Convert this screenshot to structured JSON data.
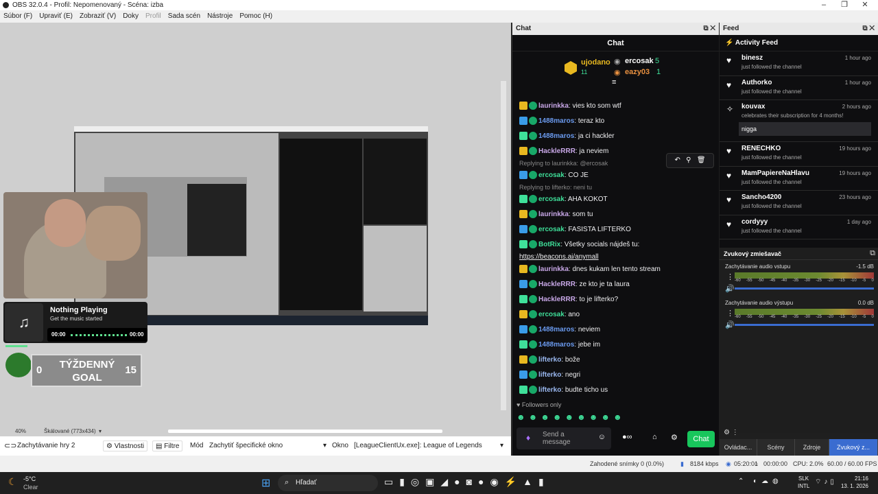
{
  "window": {
    "title": "OBS 32.0.4 - Profil: Nepomenovaný - Scéna: izba"
  },
  "menu": [
    "Súbor (F)",
    "Upraviť (E)",
    "Zobraziť (V)",
    "Doky",
    "Profil",
    "Sada scén",
    "Nástroje",
    "Pomoc (H)"
  ],
  "overlay": {
    "music_title": "Nothing Playing",
    "music_sub": "Get the music started",
    "time_start": "00:00",
    "time_end": "00:00",
    "goal_label": "TÝŽDENNÝ GOAL",
    "goal_min": "0",
    "goal_max": "15"
  },
  "preview": {
    "zoom": "40%",
    "scale": "Škálované (773x434)"
  },
  "source_bar": {
    "source": "Zachytávanie hry 2",
    "properties": "Vlastnosti",
    "filters": "Filtre",
    "mode_label": "Mód",
    "mode_value": "Zachytiť špecifické okno",
    "window_label": "Okno",
    "window_value": "[LeagueClientUx.exe]: League of Legends"
  },
  "chat": {
    "dock_title": "Chat",
    "header": "Chat",
    "leader1": {
      "name": "ujodano",
      "count": "11"
    },
    "leader2": {
      "name": "ercosak",
      "count": "5"
    },
    "leader3": {
      "name": "eazy03",
      "count": "1"
    },
    "messages": [
      {
        "user": "laurinkka",
        "text": "vies kto som wtf",
        "color": "#c9a8e8"
      },
      {
        "user": "1488maros",
        "text": "teraz kto",
        "color": "#6b9bf0"
      },
      {
        "user": "1488maros",
        "text": "ja ci hackler",
        "color": "#6b9bf0"
      },
      {
        "user": "HackleRRR",
        "text": "ja neviem",
        "color": "#c9a8e8"
      },
      {
        "user": "ercosak",
        "text": "CO JE",
        "color": "#3fe09a",
        "reply": "Replying to laurinkka: @ercosak"
      },
      {
        "user": "ercosak",
        "text": "AHA KOKOT",
        "color": "#3fe09a",
        "reply": "Replying to lifterko: neni tu"
      },
      {
        "user": "laurinkka",
        "text": "som tu",
        "color": "#c9a8e8"
      },
      {
        "user": "ercosak",
        "text": "FASISTA LIFTERKO",
        "color": "#3fe09a"
      },
      {
        "user": "BotRix",
        "text": "Všetky socials nájdeš tu:",
        "color": "#3fe09a",
        "link": "https://beacons.ai/anymall"
      },
      {
        "user": "laurinkka",
        "text": "dnes kukam len tento stream",
        "color": "#c9a8e8"
      },
      {
        "user": "HackleRRR",
        "text": "ze kto je ta laura",
        "color": "#c9a8e8"
      },
      {
        "user": "HackleRRR",
        "text": "to je lifterko?",
        "color": "#c9a8e8"
      },
      {
        "user": "ercosak",
        "text": "ano",
        "color": "#3fe09a"
      },
      {
        "user": "1488maros",
        "text": "neviem",
        "color": "#6b9bf0"
      },
      {
        "user": "1488maros",
        "text": "jebe im",
        "color": "#6b9bf0"
      },
      {
        "user": "lifterko",
        "text": "bože",
        "color": "#9ab8f0"
      },
      {
        "user": "lifterko",
        "text": "negri",
        "color": "#9ab8f0"
      },
      {
        "user": "lifterko",
        "text": "budte ticho us",
        "color": "#9ab8f0"
      }
    ],
    "followers_only": "Followers only",
    "input_placeholder": "Send a message",
    "send_label": "Chat"
  },
  "feed": {
    "dock_title": "Feed",
    "header": "Activity Feed",
    "items": [
      {
        "name": "binesz",
        "sub": "just followed the channel",
        "time": "1 hour ago"
      },
      {
        "name": "Authorko",
        "sub": "just followed the channel",
        "time": "1 hour ago"
      },
      {
        "name": "kouvax",
        "sub": "celebrates their subscription for 4 months!",
        "time": "2 hours ago",
        "note": "nigga"
      },
      {
        "name": "RENECHKO",
        "sub": "just followed the channel",
        "time": "19 hours ago"
      },
      {
        "name": "MamPapiereNaHlavu",
        "sub": "just followed the channel",
        "time": "19 hours ago"
      },
      {
        "name": "Sancho4200",
        "sub": "just followed the channel",
        "time": "23 hours ago"
      },
      {
        "name": "cordyyy",
        "sub": "just followed the channel",
        "time": "1 day ago"
      }
    ]
  },
  "mixer": {
    "title": "Zvukový zmiešavač",
    "ch1_name": "Zachytávanie audio vstupu",
    "ch1_db": "-1.5 dB",
    "ch2_name": "Zachytávanie audio výstupu",
    "ch2_db": "0.0 dB",
    "scale": [
      "-60",
      "-55",
      "-50",
      "-45",
      "-40",
      "-35",
      "-30",
      "-25",
      "-20",
      "-15",
      "-10",
      "-5",
      "0"
    ]
  },
  "dock_tabs": [
    "Ovládac...",
    "Scény",
    "Zdroje",
    "Zvukový z..."
  ],
  "status": {
    "dropped": "Zahodené snímky 0 (0.0%)",
    "kbps": "8184 kbps",
    "live": "05:20:01",
    "rec": "00:00:00",
    "cpu": "CPU: 2.0%",
    "fps": "60.00 / 60.00 FPS"
  },
  "taskbar": {
    "weather_temp": "-5°C",
    "weather_text": "Clear",
    "search": "Hľadať",
    "lang1": "SLK",
    "lang2": "INTL",
    "time": "21:16",
    "date": "13. 1. 2026"
  }
}
